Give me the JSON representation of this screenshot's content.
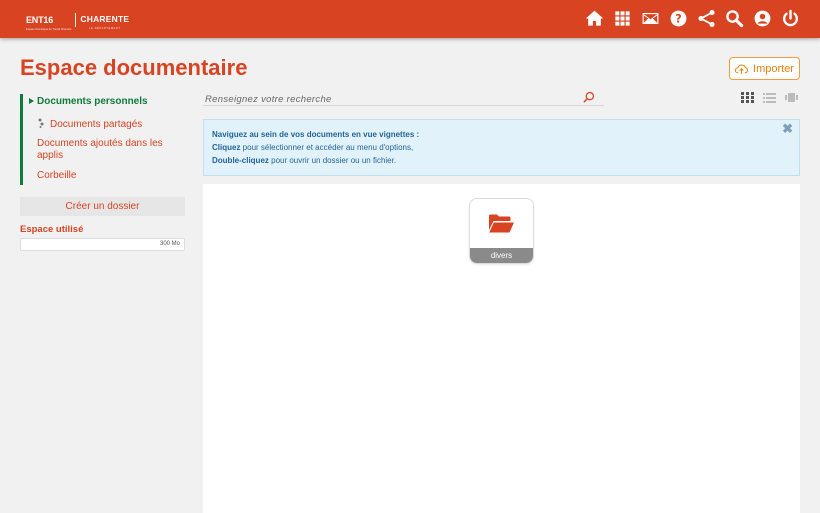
{
  "header": {
    "logo": {
      "ent": "ENT16",
      "sub": "Espace Numérique de Travail Charente",
      "name": "CHARENTE",
      "tagline": "LE DÉPARTEMENT"
    },
    "icons": [
      "home-icon",
      "apps-grid-icon",
      "mail-icon",
      "help-icon",
      "share-icon",
      "search-icon",
      "user-icon",
      "power-icon"
    ]
  },
  "page": {
    "title": "Espace documentaire",
    "import_label": "Importer"
  },
  "sidebar": {
    "items": [
      {
        "label": "Documents personnels",
        "active": true
      },
      {
        "label": "Documents partagés",
        "active": false
      },
      {
        "label": "Documents ajoutés dans les applis",
        "active": false
      },
      {
        "label": "Corbeille",
        "active": false
      }
    ],
    "create_folder": "Créer un dossier",
    "space_label": "Espace utilisé",
    "space_value": "300 Mo",
    "space_used_fraction": 0
  },
  "search": {
    "placeholder": "Renseignez votre recherche"
  },
  "info": {
    "line1": "Naviguez au sein de vos documents en vue vignettes :",
    "line2_bold": "Cliquez",
    "line2_rest": " pour sélectionner et accéder au menu d'options,",
    "line3_bold": "Double-cliquez",
    "line3_rest": " pour ouvrir un dossier ou un fichier.",
    "close": "✖"
  },
  "folders": [
    {
      "name": "divers"
    }
  ],
  "colors": {
    "brand": "#d84321",
    "accent_green": "#0e7a3f",
    "import": "#e8820c",
    "info_text": "#23649a"
  }
}
